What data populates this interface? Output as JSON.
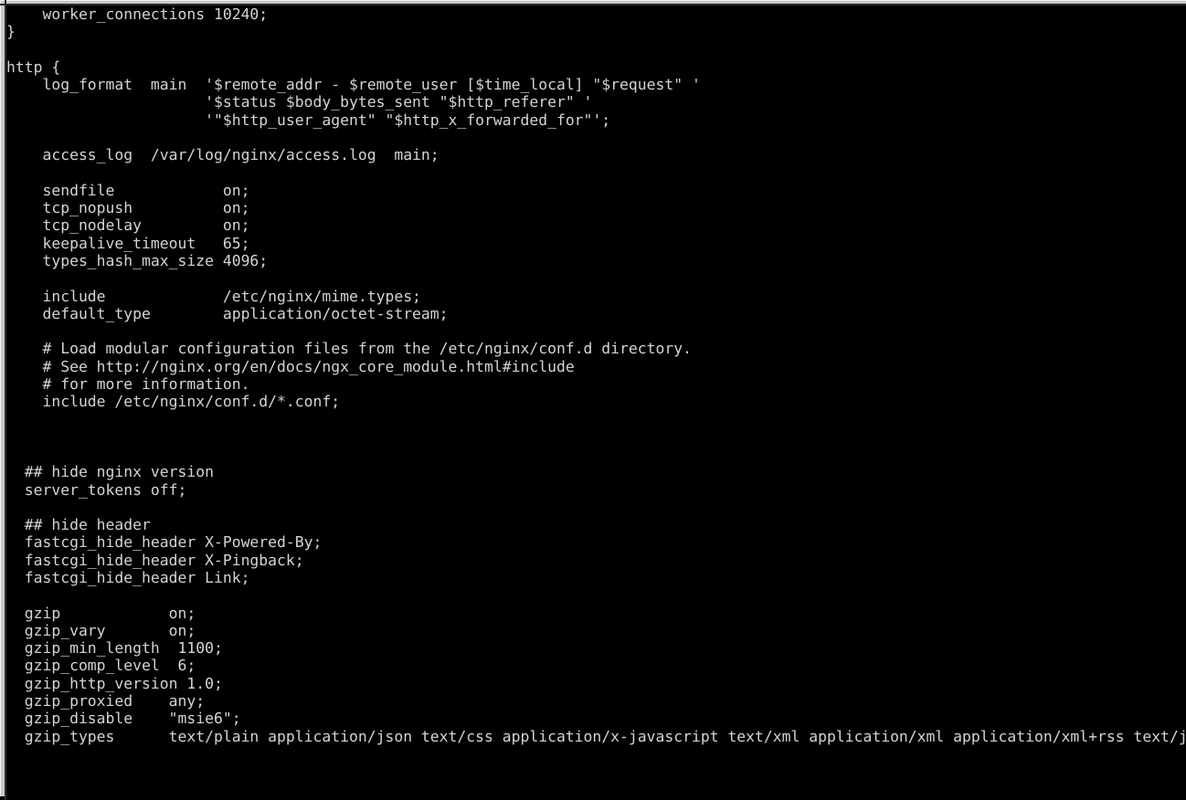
{
  "window": {
    "type": "terminal-emulator",
    "chrome_color": "#c8c8c8",
    "background_color": "#000000",
    "foreground_color": "#d4d4d4"
  },
  "terminal": {
    "file_kind": "nginx configuration file",
    "wrap_enabled": true,
    "content": "    worker_connections 10240;\n}\n\nhttp {\n    log_format  main  '$remote_addr - $remote_user [$time_local] \"$request\" '\n                      '$status $body_bytes_sent \"$http_referer\" '\n                      '\"$http_user_agent\" \"$http_x_forwarded_for\"';\n\n    access_log  /var/log/nginx/access.log  main;\n\n    sendfile            on;\n    tcp_nopush          on;\n    tcp_nodelay         on;\n    keepalive_timeout   65;\n    types_hash_max_size 4096;\n\n    include             /etc/nginx/mime.types;\n    default_type        application/octet-stream;\n\n    # Load modular configuration files from the /etc/nginx/conf.d directory.\n    # See http://nginx.org/en/docs/ngx_core_module.html#include\n    # for more information.\n    include /etc/nginx/conf.d/*.conf;\n\n\n\n  ## hide nginx version\n  server_tokens off;\n\n  ## hide header\n  fastcgi_hide_header X-Powered-By;\n  fastcgi_hide_header X-Pingback;\n  fastcgi_hide_header Link;\n\n  gzip            on;\n  gzip_vary       on;\n  gzip_min_length  1100;\n  gzip_comp_level  6;\n  gzip_http_version 1.0;\n  gzip_proxied    any;\n  gzip_disable    \"msie6\";\n  gzip_types      text/plain application/json text/css application/x-javascript text/xml application/xml application/xml+rss text/javascript image/jpeg;"
  }
}
